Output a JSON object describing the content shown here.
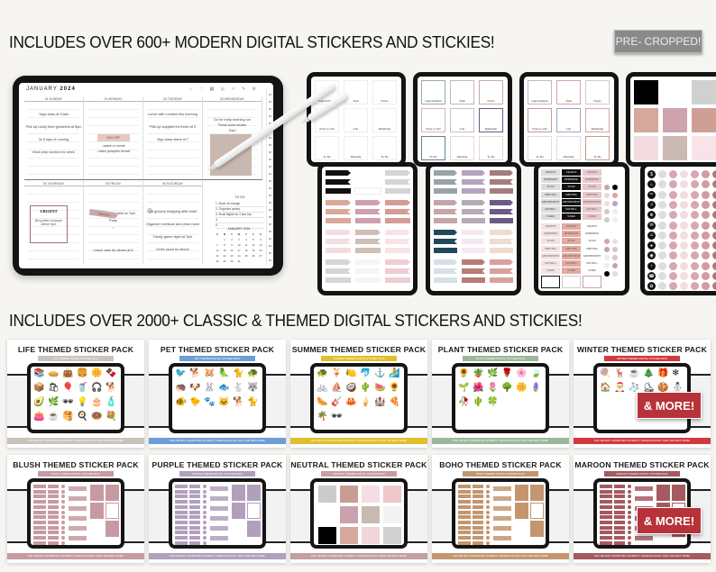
{
  "headings": {
    "modern": "INCLUDES OVER 600+ MODERN DIGITAL STICKERS AND STICKIES!",
    "classic": "INCLUDES OVER 2000+ CLASSIC & THEMED DIGITAL STICKERS AND STICKIES!"
  },
  "badge": "PRE- CROPPED!",
  "planner": {
    "month": "JANUARY",
    "year": "2024",
    "days_top": [
      "01 SUNDAY",
      "01 MONDAY",
      "02 TUESDAY",
      "03 WEDNESDAY"
    ],
    "days_bottom": [
      "04 THURSDAY",
      "05 FRIDAY",
      "06 SATURDAY"
    ],
    "entries": {
      "sunday": [
        "Yoga class at 10am",
        "Pick up Lucky from groomers at 5pm",
        "3x 5 laps of running",
        "Meal prep lunches for week"
      ],
      "monday": [
        "DAY OFF",
        "- watch a movie",
        "- bake pumpkin bread"
      ],
      "tuesday": [
        "Lunch with Lorraine this morning",
        "Pick up supplies for Kevin at 3",
        "Sign class starts at 7"
      ],
      "wednesday": [
        "Go for early morning run",
        "Finish work emails",
        "Gym"
      ],
      "thursday_urgent_title": "URGENT",
      "thursday_urgent_text": "Bring letter to lawyer before 5pm",
      "friday": [
        "Tomorrow",
        "Meet at 7pm",
        "Party",
        "Leave cake for dinner at 6"
      ],
      "saturday": [
        "Go grocery shopping after work",
        "Organize notebook and clean room",
        "Family game night at 7pm",
        "Order pizza for dinner"
      ]
    },
    "todo_title": "TO DO",
    "todo": [
      "Book oil change",
      "Organize pantry",
      "Book flights for Cabo trip",
      "",
      ""
    ],
    "calendar_title": "JANUARY 2024",
    "calendar_days": [
      "S",
      "M",
      "T",
      "W",
      "T",
      "F",
      "S"
    ],
    "calendar_dates": [
      "",
      "1",
      "2",
      "3",
      "4",
      "5",
      "6",
      "7",
      "8",
      "9",
      "10",
      "11",
      "12",
      "13",
      "14",
      "15",
      "16",
      "17",
      "18",
      "19",
      "20",
      "21",
      "22",
      "23",
      "24",
      "25",
      "26",
      "27",
      "28",
      "29",
      "30",
      "31",
      "",
      "",
      ""
    ]
  },
  "notes_sheet": {
    "labels": [
      "Appointment",
      "Task",
      "Notes",
      "Note to self",
      "List",
      "Reminder",
      "To Do",
      "Meeting",
      "To Do"
    ]
  },
  "label_sheet": {
    "rows": [
      "URGENT",
      "REMINDER",
      "TO DO",
      "MEETING",
      "APPOINTMENT",
      "PAY BILL",
      "WORK"
    ]
  },
  "packs": [
    {
      "title": "LIFE THEMED STICKER PACK",
      "subtitle": "LIFE THEMED DIGITAL STICKER PACK",
      "footer": "FOR USE WITH GOODNOTES, NOTABILITY, SAMSUNG NOTES, XODO, AND MANY MORE!",
      "accent": "#c9c3bd",
      "items": [
        "📚",
        "🥧",
        "👜",
        "🍔",
        "🌼",
        "🍫",
        "📦",
        "🛍",
        "🎈",
        "🥤",
        "🎧",
        "🐕",
        "🥑",
        "🌿",
        "🕶",
        "💡",
        "🎂",
        "🧴",
        "👛",
        "☕",
        "🥞",
        "🍳",
        "🍩",
        "💐"
      ]
    },
    {
      "title": "PET THEMED STICKER PACK",
      "subtitle": "PET THEMED DIGITAL STICKER PACK",
      "footer": "FOR USE WITH GOODNOTES, NOTABILITY, SAMSUNG NOTES, XODO, AND MANY MORE!",
      "accent": "#6f9ed6",
      "items": [
        "🐦",
        "🐕",
        "🐹",
        "🦜",
        "🐈",
        "🐢",
        "🦔",
        "🐶",
        "🐰",
        "🐟",
        "🐇",
        "🐺",
        "🐠",
        "🐤",
        "🐾",
        "🐱",
        "🐕",
        "🐈"
      ]
    },
    {
      "title": "SUMMER THEMED STICKER PACK",
      "subtitle": "SUMMER THEMED DIGITAL STICKER PACK",
      "footer": "FOR USE WITH GOODNOTES, NOTABILITY, SAMSUNG NOTES, XODO, AND MANY MORE!",
      "accent": "#e0bf2d",
      "items": [
        "🐢",
        "🍹",
        "🍋",
        "🐬",
        "⚓",
        "🏄",
        "🚲",
        "⛵",
        "🥥",
        "🌵",
        "🍉",
        "🌻",
        "🌭",
        "🎸",
        "🦀",
        "🍦",
        "🏰",
        "🍕",
        "🌴",
        "🕶"
      ]
    },
    {
      "title": "PLANT THEMED STICKER PACK",
      "subtitle": "PLANT THEMED DIGITAL STICKER PACK",
      "footer": "FOR USE WITH GOODNOTES, NOTABILITY, SAMSUNG NOTES, XODO, AND MANY MORE!",
      "accent": "#9bb99a",
      "items": [
        "🌻",
        "🪴",
        "🌿",
        "🌹",
        "🌸",
        "🍃",
        "🌱",
        "🌺",
        "🌷",
        "🌳",
        "🌼",
        "🪻",
        "🥀",
        "🌵",
        "🍀"
      ]
    },
    {
      "title": "WINTER THEMED STICKER PACK",
      "subtitle": "WINTER THEMED DIGITAL STICKER PACK",
      "footer": "FOR USE WITH GOODNOTES, NOTABILITY, SAMSUNG NOTES, XODO, AND MANY MORE!",
      "accent": "#d2393f",
      "items": [
        "🍭",
        "🦌",
        "☕",
        "🎄",
        "🎁",
        "❄",
        "🏠",
        "🎅",
        "🧦",
        "⛸",
        "🍪",
        "⛄"
      ],
      "more": "& MORE!"
    },
    {
      "title": "BLUSH THEMED STICKER PACK",
      "subtitle": "BLUSH THEMED DIGITAL STICKER PACK",
      "footer": "FOR USE WITH GOODNOTES, NOTABILITY, SAMSUNG NOTES, XODO, AND MANY MORE!",
      "accent": "#c79aa2"
    },
    {
      "title": "PURPLE THEMED STICKER PACK",
      "subtitle": "PURPLE THEMED DIGITAL STICKER PACK",
      "footer": "FOR USE WITH GOODNOTES, NOTABILITY, SAMSUNG NOTES, XODO, AND MANY MORE!",
      "accent": "#b1a0bc"
    },
    {
      "title": "NEUTRAL THEMED STICKER PACK",
      "subtitle": "NEUTRAL THEMED DIGITAL STICKER PACK",
      "footer": "FOR USE WITH GOODNOTES, NOTABILITY, SAMSUNG NOTES, XODO, AND MANY MORE!",
      "accent": "#c49ea0"
    },
    {
      "title": "BOHO THEMED STICKER PACK",
      "subtitle": "BOHO THEMED DIGITAL STICKER PACK",
      "footer": "FOR USE WITH GOODNOTES, NOTABILITY, SAMSUNG NOTES, XODO, AND MANY MORE!",
      "accent": "#c39670"
    },
    {
      "title": "MAROON THEMED STICKER PACK",
      "subtitle": "MAROON THEMED DIGITAL STICKER PACK",
      "footer": "FOR USE WITH GOODNOTES, NOTABILITY, SAMSUNG NOTES, XODO, AND MANY MORE!",
      "accent": "#a45a60",
      "more": "& MORE!"
    }
  ],
  "palettes": {
    "flags_a": [
      "#111111",
      "#ffffff",
      "#d4d4d4",
      "#dba99c",
      "#cf9fac",
      "#d49c92",
      "#f3dde0",
      "#cfbfb6",
      "#f9e3e7",
      "#d7d5d2",
      "#f5f4f6",
      "#efcdd2"
    ],
    "flags_b": [
      "#9aa3a5",
      "#b3a5bb",
      "#a67d7e",
      "#c6a4a8",
      "#b7a9b6",
      "#6c5a86",
      "#1f4a5b",
      "#f6e8f1",
      "#eedcd0",
      "#d6e0e8",
      "#b77c75",
      "#d9a19d"
    ],
    "swatches": [
      "#000000",
      "#ffffff",
      "#d0d0d0",
      "#d6a79d",
      "#cda3ae",
      "#cf9f95",
      "#f3dbe0",
      "#cbbab1",
      "#f8e3e9"
    ],
    "neutral_swatches": [
      "#cbcbcb",
      "#c99d95",
      "#f6dde3",
      "#efc8c9",
      "#ffffff",
      "#caa2ae",
      "#c8bab1",
      "#f3f3f5",
      "#000000",
      "#d7a99e",
      "#f0d6da",
      "#d0d0d0"
    ]
  }
}
